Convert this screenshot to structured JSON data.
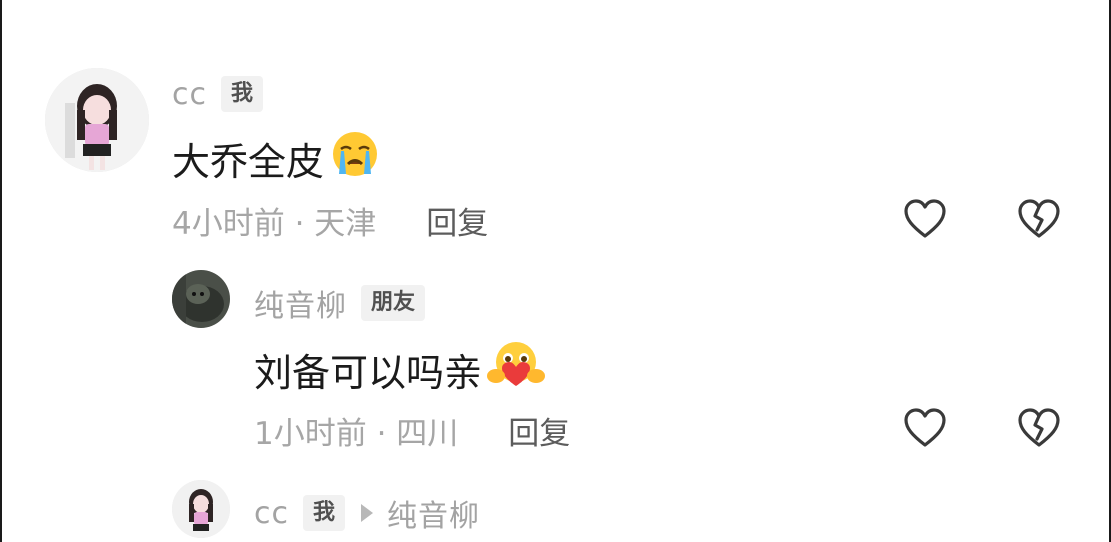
{
  "comments": [
    {
      "username": "cc",
      "tag": "我",
      "content": "大乔全皮",
      "emoji": "crying-face",
      "time_location": "4小时前 · 天津",
      "reply_label": "回复"
    },
    {
      "username": "纯音柳",
      "tag": "朋友",
      "content": "刘备可以吗亲",
      "emoji": "hugging-heart-face",
      "time_location": "1小时前 · 四川",
      "reply_label": "回复"
    },
    {
      "username": "cc",
      "tag": "我",
      "reply_to": "纯音柳"
    }
  ],
  "colors": {
    "username": "#a3a3a3",
    "content": "#1b1b1b",
    "meta": "#a6a6a6",
    "reply": "#5c5c5c",
    "tag_bg": "#f1f1f1",
    "icon": "#3a3a3a"
  },
  "icons": {
    "like": "heart-outline-icon",
    "dislike": "broken-heart-icon"
  }
}
